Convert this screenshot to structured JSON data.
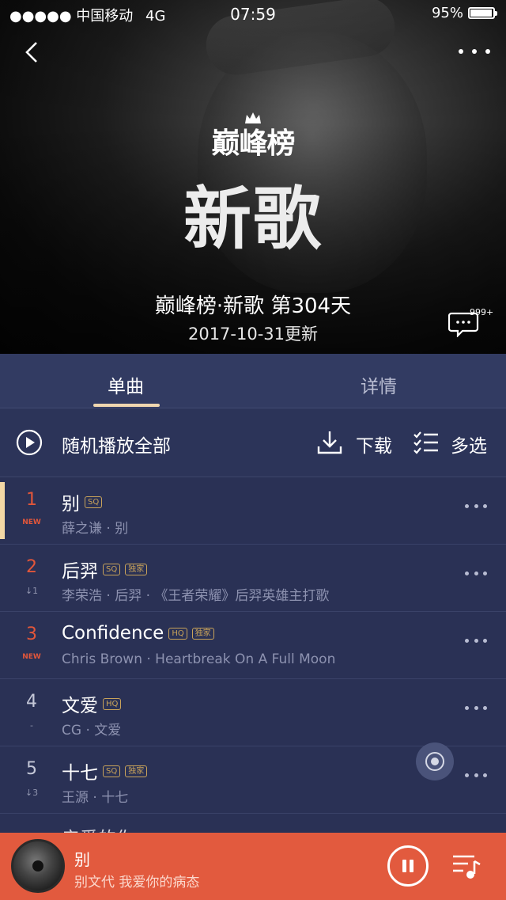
{
  "status_bar": {
    "signal": "●●●●● 中国移动",
    "network": "4G",
    "time": "07:59",
    "battery": "95%",
    "battery_level": 0.95
  },
  "hero": {
    "logo_text": "巅峰榜",
    "big_title": "新歌",
    "subtitle": "巅峰榜·新歌 第304天",
    "update_date": "2017-10-31更新",
    "comment_count": "999+"
  },
  "tabs": [
    {
      "label": "单曲",
      "active": true
    },
    {
      "label": "详情",
      "active": false
    }
  ],
  "actions": {
    "play_all": "随机播放全部",
    "download": "下载",
    "multi_select": "多选"
  },
  "songs": [
    {
      "rank": "1",
      "trend": "NEW",
      "title": "别",
      "badges": [
        "SQ"
      ],
      "sub": "薛之谦 · 别"
    },
    {
      "rank": "2",
      "trend": "↓1",
      "title": "后羿",
      "badges": [
        "SQ",
        "独家"
      ],
      "sub": "李荣浩 · 后羿 · 《王者荣耀》后羿英雄主打歌"
    },
    {
      "rank": "3",
      "trend": "NEW",
      "title": "Confidence",
      "badges": [
        "HQ",
        "独家"
      ],
      "sub": "Chris Brown · Heartbreak On A Full Moon"
    },
    {
      "rank": "4",
      "trend": "-",
      "title": "文爱",
      "badges": [
        "HQ"
      ],
      "sub": "CG · 文爱"
    },
    {
      "rank": "5",
      "trend": "↓3",
      "title": "十七",
      "badges": [
        "SQ",
        "独家"
      ],
      "sub": "王源 · 十七"
    }
  ],
  "peek_row": "亲爱的你",
  "player": {
    "song_name": "别",
    "lyric": "别文代 我爱你的病态"
  },
  "colors": {
    "list_bg": "#2a3155",
    "accent_underline": "#f0d7b0",
    "rank_red": "#e2563a",
    "player_bg": "#e25a3e",
    "badge_gold": "#c9a35a"
  }
}
